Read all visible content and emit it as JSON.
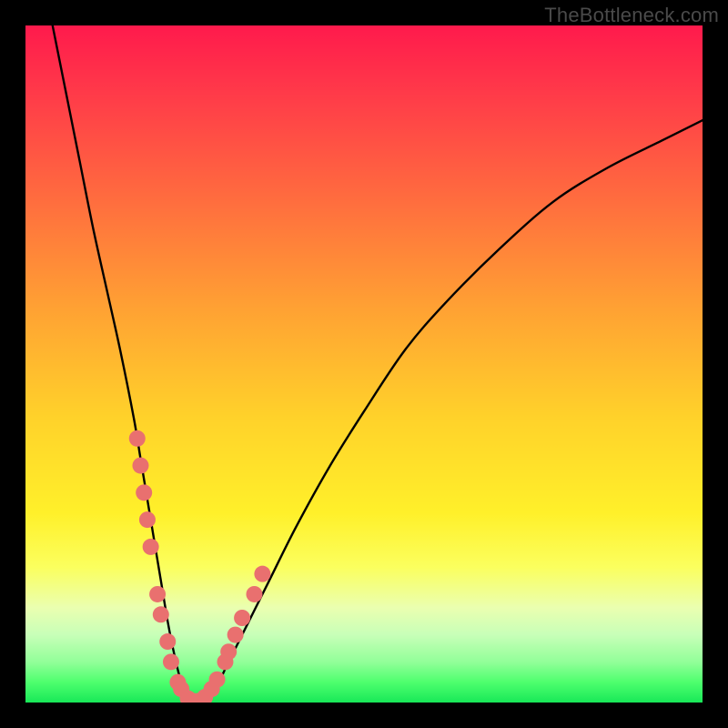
{
  "watermark": "TheBottleneck.com",
  "chart_data": {
    "type": "line",
    "title": "",
    "xlabel": "",
    "ylabel": "",
    "xlim": [
      0,
      100
    ],
    "ylim": [
      0,
      100
    ],
    "grid": false,
    "legend": false,
    "series": [
      {
        "name": "bottleneck-curve",
        "x": [
          4,
          6,
          8,
          10,
          12,
          14,
          16,
          17,
          18,
          19,
          20,
          21,
          22,
          23,
          24,
          25,
          26,
          28,
          30,
          33,
          36,
          40,
          45,
          50,
          56,
          62,
          70,
          78,
          86,
          94,
          100
        ],
        "y": [
          100,
          90,
          80,
          70,
          61,
          52,
          42,
          36,
          30,
          24,
          18,
          12,
          7,
          3,
          1,
          0,
          0,
          2,
          6,
          12,
          18,
          26,
          35,
          43,
          52,
          59,
          67,
          74,
          79,
          83,
          86
        ]
      }
    ],
    "markers": {
      "name": "highlighted-points",
      "color": "#e9706f",
      "points_xy": [
        [
          16.5,
          39
        ],
        [
          17.0,
          35
        ],
        [
          17.5,
          31
        ],
        [
          18.0,
          27
        ],
        [
          18.5,
          23
        ],
        [
          19.5,
          16
        ],
        [
          20.0,
          13
        ],
        [
          21.0,
          9
        ],
        [
          21.5,
          6
        ],
        [
          22.5,
          3
        ],
        [
          23.0,
          2
        ],
        [
          24.0,
          0.6
        ],
        [
          24.8,
          0.2
        ],
        [
          25.5,
          0.2
        ],
        [
          26.5,
          0.8
        ],
        [
          27.5,
          2.0
        ],
        [
          28.3,
          3.4
        ],
        [
          29.5,
          6
        ],
        [
          30.0,
          7.5
        ],
        [
          31.0,
          10
        ],
        [
          32.0,
          12.5
        ],
        [
          33.8,
          16
        ],
        [
          35.0,
          19
        ]
      ]
    },
    "background_gradient": {
      "top": "#ff1a4c",
      "mid": "#ffe427",
      "bottom": "#18e858"
    }
  }
}
